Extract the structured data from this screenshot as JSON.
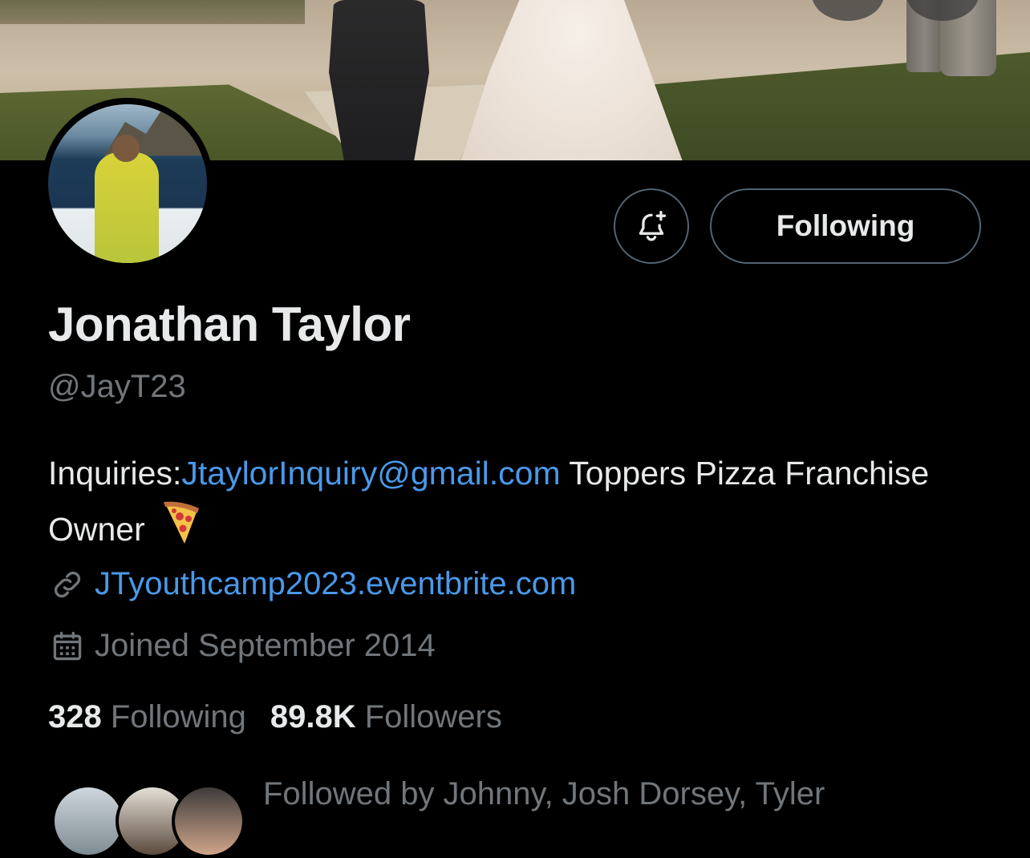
{
  "profile": {
    "name": "Jonathan Taylor",
    "handle": "@JayT23",
    "bio_prefix": "Inquiries:",
    "bio_email": "JtaylorInquiry@gmail.com",
    "bio_suffix": " Toppers Pizza Franchise Owner",
    "bio_emoji": "pizza-emoji",
    "website": "JTyouthcamp2023.eventbrite.com",
    "joined": "Joined September 2014"
  },
  "actions": {
    "notify_icon": "bell-plus-icon",
    "following_label": "Following"
  },
  "counts": {
    "following_value": "328",
    "following_label": "Following",
    "followers_value": "89.8K",
    "followers_label": "Followers"
  },
  "followed_by": {
    "text": "Followed by Johnny, Josh Dorsey, Tyler"
  },
  "colors": {
    "background": "#000000",
    "text_primary": "#e7e9ea",
    "text_secondary": "#71767b",
    "link": "#4a99e9",
    "button_border": "#536471"
  }
}
